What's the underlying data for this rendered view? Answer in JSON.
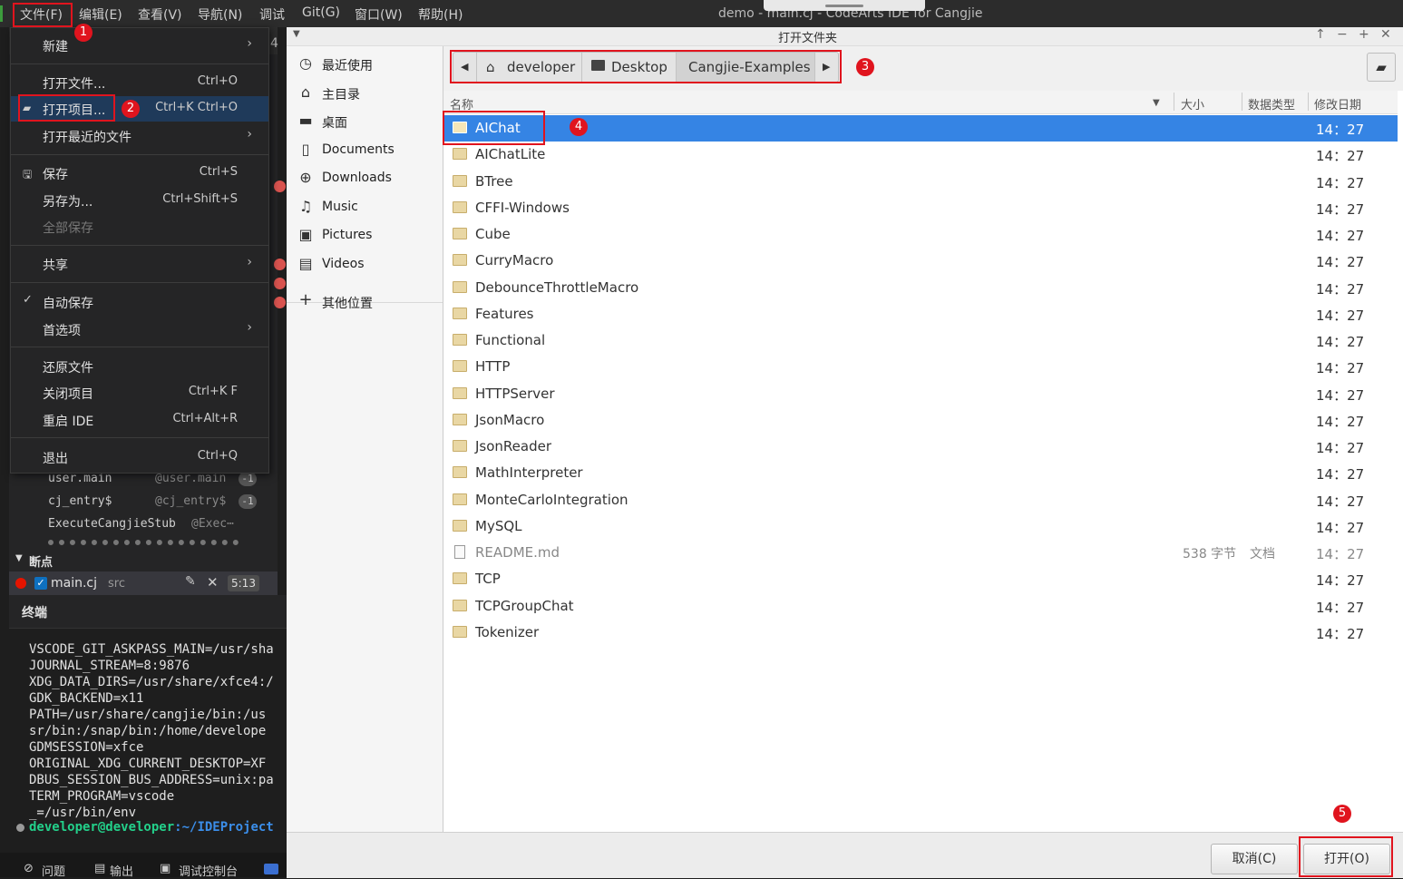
{
  "menubar": {
    "items": [
      "文件(F)",
      "编辑(E)",
      "查看(V)",
      "导航(N)",
      "调试",
      "Git(G)",
      "窗口(W)",
      "帮助(H)"
    ],
    "window_title": "demo - main.cj - CodeArts IDE for Cangjie"
  },
  "file_menu": {
    "new": "新建",
    "open_file": "打开文件...",
    "open_file_shortcut": "Ctrl+O",
    "open_project": "打开项目...",
    "open_project_shortcut": "Ctrl+K Ctrl+O",
    "open_recent": "打开最近的文件",
    "save": "保存",
    "save_shortcut": "Ctrl+S",
    "save_as": "另存为...",
    "save_as_shortcut": "Ctrl+Shift+S",
    "save_all": "全部保存",
    "share": "共享",
    "auto_save": "自动保存",
    "preferences": "首选项",
    "revert": "还原文件",
    "close_project": "关闭项目",
    "close_project_shortcut": "Ctrl+K F",
    "restart": "重启 IDE",
    "restart_shortcut": "Ctrl+Alt+R",
    "exit": "退出",
    "exit_shortcut": "Ctrl+Q"
  },
  "call_stack": [
    {
      "name": "user.main",
      "sub": "@user.main",
      "count": "-1"
    },
    {
      "name": "cj_entry$",
      "sub": "@cj_entry$",
      "count": "-1"
    },
    {
      "name": "ExecuteCangjieStub",
      "sub": "@Exec⋯",
      "count": ""
    }
  ],
  "breakpoints": {
    "header": "断点",
    "file": "main.cj",
    "folder": "src",
    "position": "5:13"
  },
  "terminal": {
    "title": "终端",
    "lines": "VSCODE_GIT_ASKPASS_MAIN=/usr/sha\nJOURNAL_STREAM=8:9876\nXDG_DATA_DIRS=/usr/share/xfce4:/\nGDK_BACKEND=x11\nPATH=/usr/share/cangjie/bin:/us\nsr/bin:/snap/bin:/home/develope\nGDMSESSION=xfce\nORIGINAL_XDG_CURRENT_DESKTOP=XF\nDBUS_SESSION_BUS_ADDRESS=unix:pa\nTERM_PROGRAM=vscode\n_=/usr/bin/env",
    "prompt_user": "developer@developer",
    "prompt_path": ":~/IDEProject"
  },
  "status_bar": {
    "problems": "问题",
    "output": "输出",
    "debug_console": "调试控制台"
  },
  "dialog": {
    "title": "打开文件夹",
    "places": [
      "最近使用",
      "主目录",
      "桌面",
      "Documents",
      "Downloads",
      "Music",
      "Pictures",
      "Videos"
    ],
    "other_locations": "其他位置",
    "path": [
      "developer",
      "Desktop",
      "Cangjie-Examples"
    ],
    "columns": {
      "name": "名称",
      "size": "大小",
      "type": "数据类型",
      "modified": "修改日期"
    },
    "files": [
      {
        "name": "AIChat",
        "size": "",
        "type": "",
        "date": "14：27",
        "kind": "folder",
        "selected": true
      },
      {
        "name": "AIChatLite",
        "size": "",
        "type": "",
        "date": "14：27",
        "kind": "folder"
      },
      {
        "name": "BTree",
        "size": "",
        "type": "",
        "date": "14：27",
        "kind": "folder"
      },
      {
        "name": "CFFI-Windows",
        "size": "",
        "type": "",
        "date": "14：27",
        "kind": "folder"
      },
      {
        "name": "Cube",
        "size": "",
        "type": "",
        "date": "14：27",
        "kind": "folder"
      },
      {
        "name": "CurryMacro",
        "size": "",
        "type": "",
        "date": "14：27",
        "kind": "folder"
      },
      {
        "name": "DebounceThrottleMacro",
        "size": "",
        "type": "",
        "date": "14：27",
        "kind": "folder"
      },
      {
        "name": "Features",
        "size": "",
        "type": "",
        "date": "14：27",
        "kind": "folder"
      },
      {
        "name": "Functional",
        "size": "",
        "type": "",
        "date": "14：27",
        "kind": "folder"
      },
      {
        "name": "HTTP",
        "size": "",
        "type": "",
        "date": "14：27",
        "kind": "folder"
      },
      {
        "name": "HTTPServer",
        "size": "",
        "type": "",
        "date": "14：27",
        "kind": "folder"
      },
      {
        "name": "JsonMacro",
        "size": "",
        "type": "",
        "date": "14：27",
        "kind": "folder"
      },
      {
        "name": "JsonReader",
        "size": "",
        "type": "",
        "date": "14：27",
        "kind": "folder"
      },
      {
        "name": "MathInterpreter",
        "size": "",
        "type": "",
        "date": "14：27",
        "kind": "folder"
      },
      {
        "name": "MonteCarloIntegration",
        "size": "",
        "type": "",
        "date": "14：27",
        "kind": "folder"
      },
      {
        "name": "MySQL",
        "size": "",
        "type": "",
        "date": "14：27",
        "kind": "folder"
      },
      {
        "name": "README.md",
        "size": "538 字节",
        "type": "文档",
        "date": "14：27",
        "kind": "file"
      },
      {
        "name": "TCP",
        "size": "",
        "type": "",
        "date": "14：27",
        "kind": "folder"
      },
      {
        "name": "TCPGroupChat",
        "size": "",
        "type": "",
        "date": "14：27",
        "kind": "folder"
      },
      {
        "name": "Tokenizer",
        "size": "",
        "type": "",
        "date": "14：27",
        "kind": "folder"
      }
    ],
    "cancel": "取消(C)",
    "open": "打开(O)"
  },
  "annotations": [
    "1",
    "2",
    "3",
    "4",
    "5"
  ],
  "colors": {
    "accent": "#3584e4",
    "highlight": "#e0141e"
  }
}
